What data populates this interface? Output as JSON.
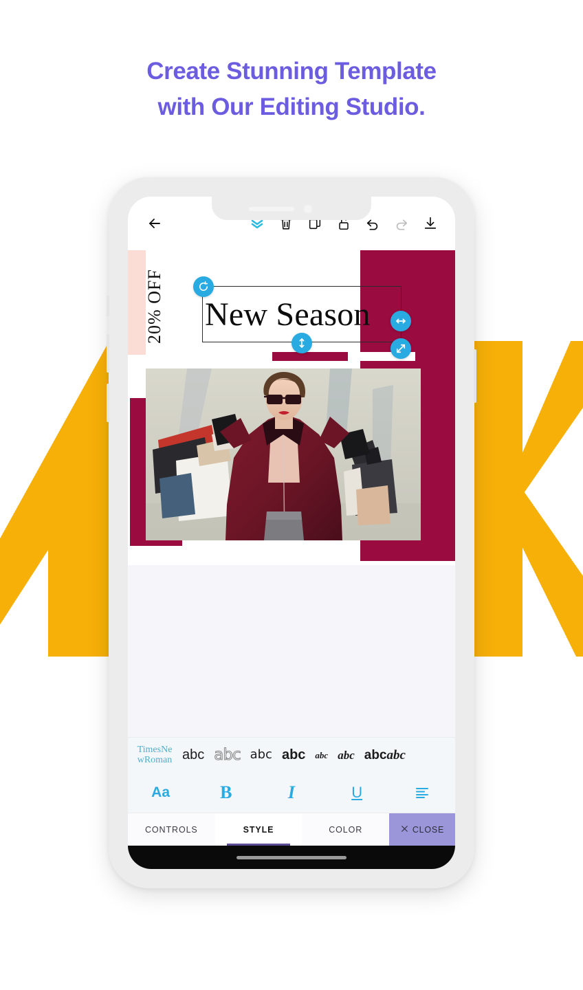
{
  "headline": {
    "line1": "Create Stunning Template",
    "line2": "with Our Editing Studio.",
    "color": "#6C5CE0"
  },
  "background": {
    "letters": [
      "A",
      "K"
    ],
    "color": "#F7B008"
  },
  "phone": {
    "frame_color": "#ECECEC",
    "screen_color": "#FFFFFF"
  },
  "toolbar": {
    "back": "back-arrow",
    "items": [
      {
        "name": "layers-chevron",
        "label": "Layers",
        "color": "#2CBBE0",
        "enabled": true
      },
      {
        "name": "delete",
        "label": "Delete",
        "color": "#111111",
        "enabled": true
      },
      {
        "name": "duplicate",
        "label": "Duplicate",
        "color": "#111111",
        "enabled": true
      },
      {
        "name": "lock",
        "label": "Unlock",
        "color": "#111111",
        "enabled": true
      },
      {
        "name": "undo",
        "label": "Undo",
        "color": "#111111",
        "enabled": true
      },
      {
        "name": "redo",
        "label": "Redo",
        "color": "#BDBDBD",
        "enabled": false
      },
      {
        "name": "download",
        "label": "Save",
        "color": "#111111",
        "enabled": true
      }
    ]
  },
  "canvas": {
    "title_text": "New Season",
    "discount_text": "20% OFF",
    "maroon": "#9A0B3F",
    "pink": "#FBDDD5",
    "handle_color": "#29ABE2",
    "handles": [
      {
        "name": "rotate-handle",
        "glyph": "rotate"
      },
      {
        "name": "resize-horizontal-handle",
        "glyph": "horizontal"
      },
      {
        "name": "resize-vertical-handle",
        "glyph": "vertical"
      },
      {
        "name": "resize-diagonal-handle",
        "glyph": "diagonal"
      }
    ]
  },
  "fonts": {
    "selected": "TimesNewRoman",
    "samples": [
      {
        "name": "font-sans",
        "label": "abc"
      },
      {
        "name": "font-outline",
        "label": "abc"
      },
      {
        "name": "font-condensed",
        "label": "abc"
      },
      {
        "name": "font-bold",
        "label": "abc"
      },
      {
        "name": "font-script-small",
        "label": "abc"
      },
      {
        "name": "font-script",
        "label": "abc"
      },
      {
        "name": "font-dual-bold",
        "label": "abc"
      },
      {
        "name": "font-dual-script",
        "label": "abc"
      }
    ]
  },
  "style_bar": {
    "accent": "#29ABE2",
    "buttons": [
      {
        "name": "font-size-button",
        "label": "Aa"
      },
      {
        "name": "bold-button",
        "label": "B"
      },
      {
        "name": "italic-button",
        "label": "I"
      },
      {
        "name": "underline-button",
        "label": "U"
      },
      {
        "name": "align-button",
        "label": "align-left"
      }
    ]
  },
  "tabs": {
    "items": [
      {
        "name": "tab-controls",
        "label": "CONTROLS",
        "active": false
      },
      {
        "name": "tab-style",
        "label": "STYLE",
        "active": true
      },
      {
        "name": "tab-color",
        "label": "COLOR",
        "active": false
      }
    ],
    "close_label": "CLOSE",
    "close_color": "#9B96D9",
    "active_underline": "#5B4C93"
  }
}
